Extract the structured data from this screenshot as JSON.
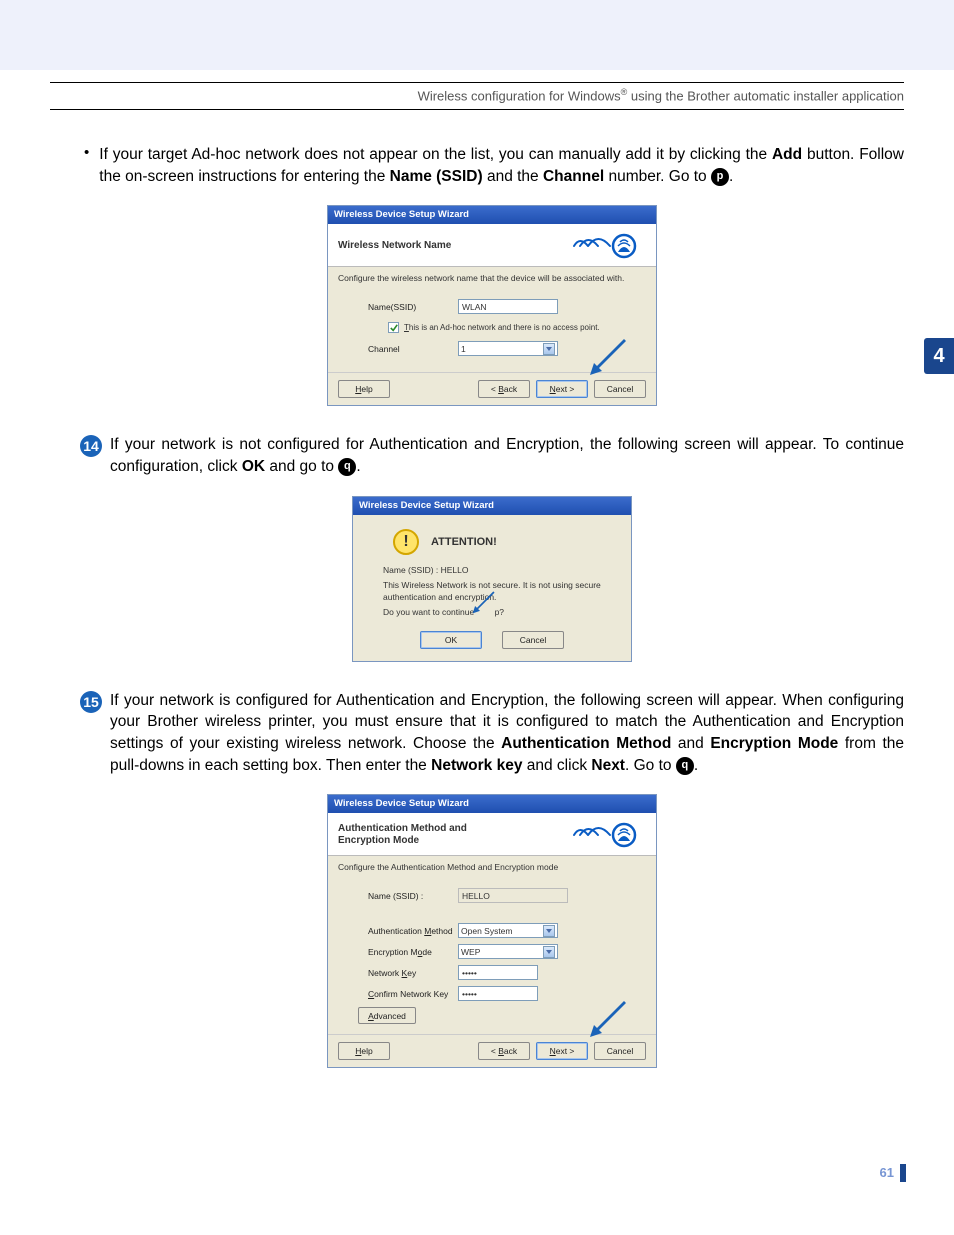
{
  "header": {
    "text_before": "Wireless configuration for Windows",
    "sup": "®",
    "text_after": " using the Brother automatic installer application"
  },
  "side_tab": "4",
  "intro": {
    "text1": "If your target Ad-hoc network does not appear on the list, you can manually add it by clicking the ",
    "add": "Add",
    "text2": " button. Follow the on-screen instructions for entering the ",
    "name_ssid": "Name (SSID)",
    "text3": " and the ",
    "channel": "Channel",
    "text4": " number. Go to ",
    "ref": "p",
    "dot": "."
  },
  "dialog1": {
    "title": "Wireless Device Setup Wizard",
    "heading": "Wireless Network Name",
    "sub": "Configure the wireless network name that the device will be associated with.",
    "ssid_label": "Name(SSID)",
    "ssid_value": "WLAN",
    "checkbox_label_a": "T",
    "checkbox_label_b": "his is an Ad-hoc network and there is no access point.",
    "channel_label": "Channel",
    "channel_value": "1",
    "help_a": "H",
    "help_b": "elp",
    "back_a": "< ",
    "back_u": "B",
    "back_b": "ack",
    "next_u": "N",
    "next_b": "ext >",
    "cancel": "Cancel"
  },
  "step14": {
    "num": "14",
    "text1": "If your network is not configured for Authentication and Encryption, the following screen will appear. To continue configuration, click ",
    "ok": "OK",
    "text2": " and go to ",
    "ref": "q",
    "dot": "."
  },
  "dialog2": {
    "title": "Wireless Device Setup Wizard",
    "attention": "ATTENTION!",
    "line1": "Name (SSID) : HELLO",
    "line2": "This Wireless Network is not secure. It is not using secure authentication and encryption.",
    "line3a": "Do you want to continue ",
    "line3b": "p?",
    "ok": "OK",
    "cancel": "Cancel"
  },
  "step15": {
    "num": "15",
    "text1": "If your network is configured for Authentication and Encryption, the following screen will appear. When configuring your Brother wireless printer, you must ensure that it is configured to match the Authentication and Encryption settings of your existing wireless network. Choose the ",
    "auth_method": "Authentication Method",
    "text2": " and ",
    "enc_mode": "Encryption Mode",
    "text3": " from the pull-downs in each setting box. Then enter the ",
    "net_key": "Network key",
    "text4": " and click ",
    "next": "Next",
    "text5": ". Go to ",
    "ref": "q",
    "dot": "."
  },
  "dialog3": {
    "title": "Wireless Device Setup Wizard",
    "heading": "Authentication Method and Encryption Mode",
    "sub": "Configure the Authentication Method and Encryption mode",
    "ssid_label": "Name (SSID) :",
    "ssid_value": "HELLO",
    "auth_label_a": "Authentication ",
    "auth_label_u": "M",
    "auth_label_b": "ethod",
    "auth_value": "Open System",
    "enc_label_a": "Encryption M",
    "enc_label_u": "o",
    "enc_label_b": "de",
    "enc_value": "WEP",
    "key_label_a": "Network ",
    "key_label_u": "K",
    "key_label_b": "ey",
    "key_value": "•••••",
    "ckey_label_u": "C",
    "ckey_label_b": "onfirm Network Key",
    "ckey_value": "•••••",
    "adv_u": "A",
    "adv_b": "dvanced",
    "help_u": "H",
    "help_b": "elp",
    "back_a": "< ",
    "back_u": "B",
    "back_b": "ack",
    "next_u": "N",
    "next_b": "ext >",
    "cancel": "Cancel"
  },
  "page_number": "61"
}
